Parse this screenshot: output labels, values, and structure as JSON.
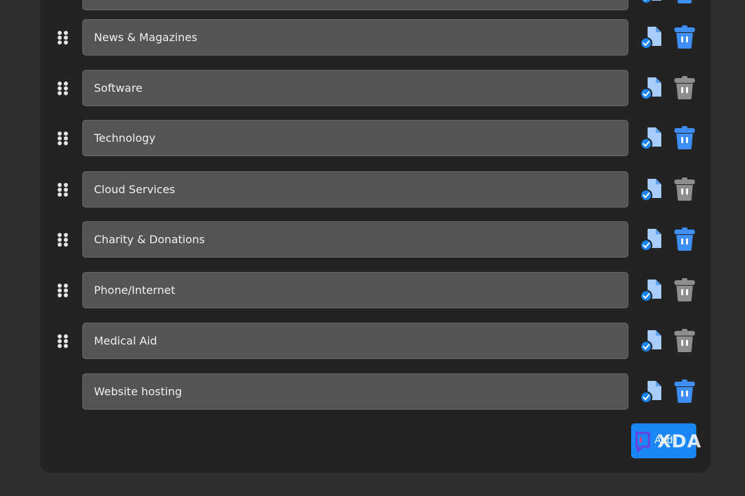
{
  "categories": [
    {
      "label": "",
      "has_drag": true,
      "trash_active": true
    },
    {
      "label": "News & Magazines",
      "has_drag": true,
      "trash_active": true
    },
    {
      "label": "Software",
      "has_drag": true,
      "trash_active": false
    },
    {
      "label": "Technology",
      "has_drag": true,
      "trash_active": true
    },
    {
      "label": "Cloud Services",
      "has_drag": true,
      "trash_active": false
    },
    {
      "label": "Charity & Donations",
      "has_drag": true,
      "trash_active": true
    },
    {
      "label": "Phone/Internet",
      "has_drag": true,
      "trash_active": false
    },
    {
      "label": "Medical Aid",
      "has_drag": true,
      "trash_active": false
    },
    {
      "label": "Website hosting",
      "has_drag": false,
      "trash_active": true
    }
  ],
  "add_button": {
    "label": "Add"
  },
  "watermark": {
    "text": "XDA"
  },
  "colors": {
    "accent": "#1a86f5",
    "trash_active": "#3d8ef5",
    "trash_inactive": "#8e8e8e",
    "doc_light": "#a9cdfa",
    "doc_mid": "#5aa0f3"
  }
}
